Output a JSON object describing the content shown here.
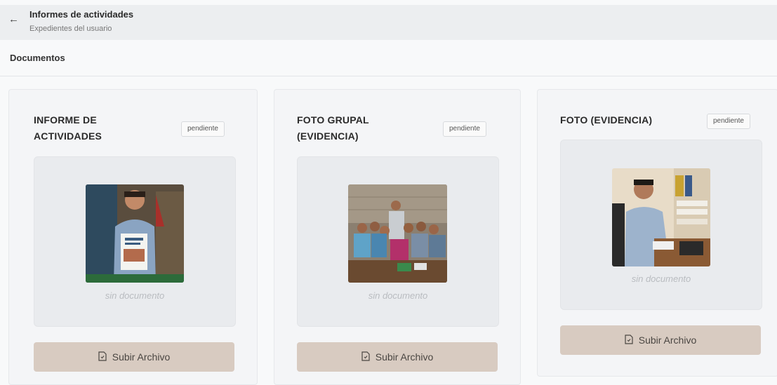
{
  "header": {
    "title": "Informes de actividades",
    "subtitle": "Expedientes del usuario"
  },
  "section": {
    "label": "Documentos"
  },
  "cards": [
    {
      "title_line1": "INFORME DE",
      "title_line2": "ACTIVIDADES",
      "status": "pendiente",
      "empty_text": "sin documento",
      "upload_label": "Subir Archivo"
    },
    {
      "title_line1": "FOTO GRUPAL",
      "title_line2": "(EVIDENCIA)",
      "status": "pendiente",
      "empty_text": "sin documento",
      "upload_label": "Subir Archivo"
    },
    {
      "title_line1": "FOTO (EVIDENCIA)",
      "title_line2": "",
      "status": "pendiente",
      "empty_text": "sin documento",
      "upload_label": "Subir Archivo"
    }
  ],
  "colors": {
    "upload_button": "#d8cbc1",
    "preview_bg": "#e9ebee"
  }
}
